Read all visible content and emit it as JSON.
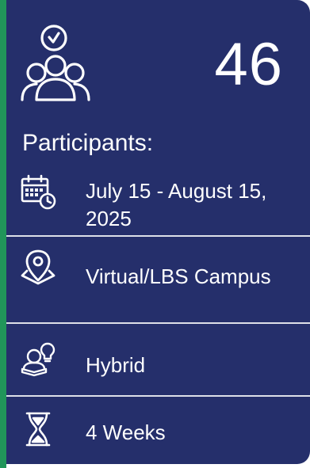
{
  "card": {
    "count": "46",
    "participants_label": "Participants:",
    "date_line_1": "July 15 - August 15,",
    "date_line_2": "2025",
    "location": "Virtual/LBS Campus",
    "format": "Hybrid",
    "duration": "4 Weeks"
  },
  "colors": {
    "card_background": "#252f6b",
    "accent_green": "#21955a",
    "text": "#ffffff"
  },
  "icons": {
    "participants": "group-clock-icon",
    "date": "calendar-clock-icon",
    "location": "location-pin-icon",
    "format": "reader-lightbulb-icon",
    "duration": "hourglass-icon"
  }
}
